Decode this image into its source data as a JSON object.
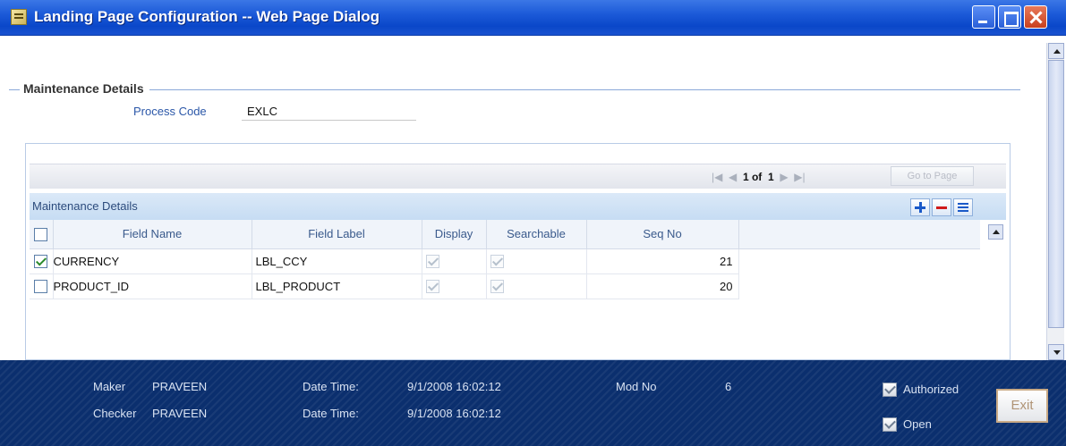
{
  "window": {
    "title": "Landing Page Configuration -- Web Page Dialog"
  },
  "section": {
    "title": "Maintenance Details",
    "process_code_label": "Process Code",
    "process_code_value": "EXLC"
  },
  "pager": {
    "first": "|◀",
    "prev": "◀",
    "current": "1",
    "of_label": "of",
    "total": "1",
    "next": "▶",
    "last": "▶|",
    "goto_label": "Go to Page"
  },
  "grid": {
    "caption": "Maintenance Details",
    "columns": [
      "Field Name",
      "Field Label",
      "Display",
      "Searchable",
      "Seq No"
    ],
    "rows": [
      {
        "selected": true,
        "field_name": "CURRENCY",
        "field_label": "LBL_CCY",
        "display": true,
        "searchable": true,
        "seq_no": "21"
      },
      {
        "selected": false,
        "field_name": "PRODUCT_ID",
        "field_label": "LBL_PRODUCT",
        "display": true,
        "searchable": true,
        "seq_no": "20"
      }
    ]
  },
  "footer": {
    "maker_label": "Maker",
    "maker_value": "PRAVEEN",
    "checker_label": "Checker",
    "checker_value": "PRAVEEN",
    "date_time_label_1": "Date Time:",
    "date_time_value_1": "9/1/2008 16:02:12",
    "date_time_label_2": "Date Time:",
    "date_time_value_2": "9/1/2008 16:02:12",
    "mod_no_label": "Mod No",
    "mod_no_value": "6",
    "authorized_label": "Authorized",
    "open_label": "Open",
    "exit_label": "Exit"
  },
  "colors": {
    "titlebar": "#0a47c9",
    "footer": "#0b2f6e",
    "label_blue": "#2b57a8"
  }
}
